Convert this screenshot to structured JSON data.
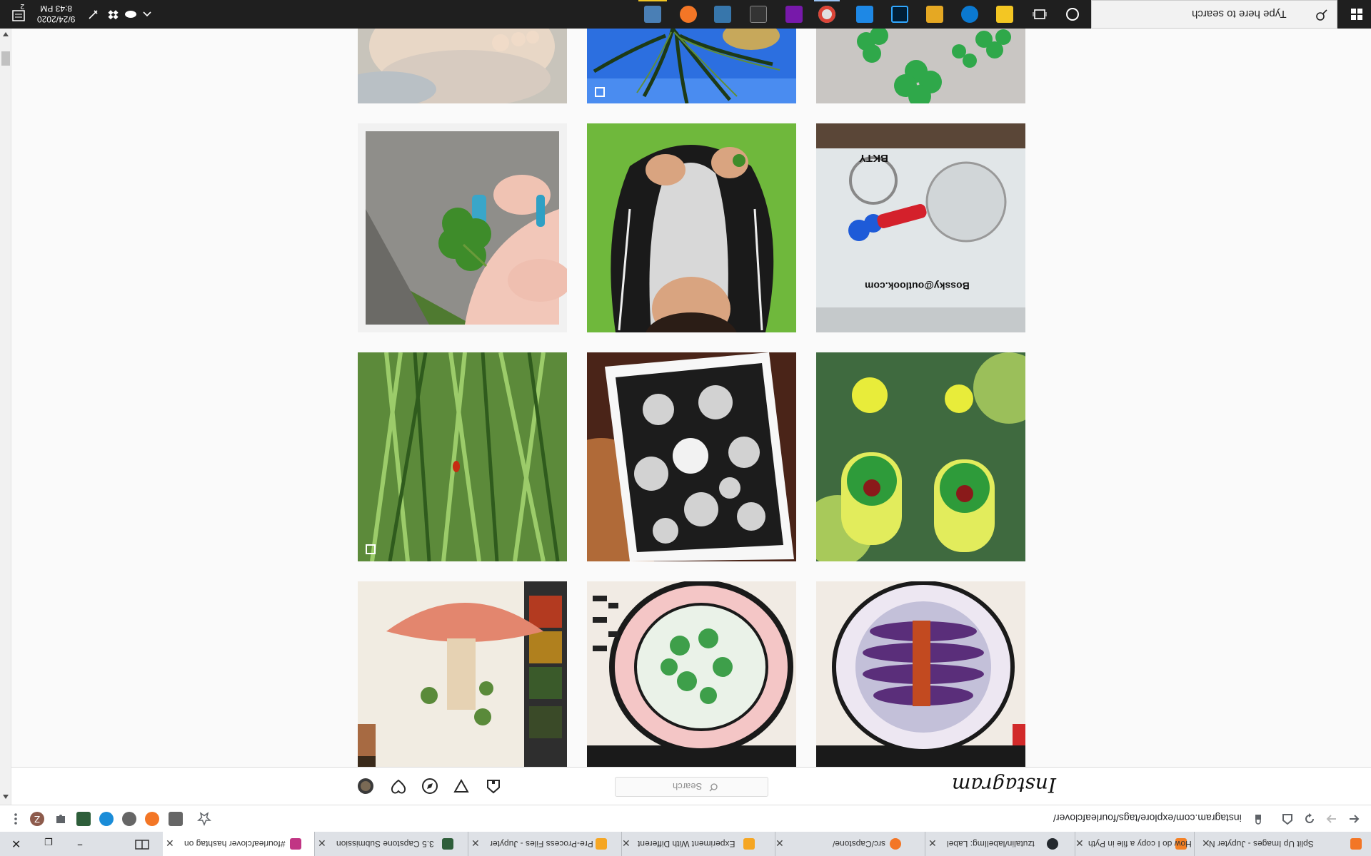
{
  "taskbar": {
    "search_placeholder": "Type here to search",
    "clock_time": "8:43 PM",
    "clock_date": "9/24/2020",
    "notification_count": "2"
  },
  "instagram": {
    "logo": "Instagram",
    "search_placeholder": "Search"
  },
  "browser": {
    "url": "instagram.com/explore/tags/fourleafclover/",
    "tabs": [
      {
        "title": "Split Up Images - Jupyter N"
      },
      {
        "title": "How do I copy a file in Pyth"
      },
      {
        "title": "tzutalin/labelImg: Label"
      },
      {
        "title": "src/Capstone/"
      },
      {
        "title": "Experiment With Different"
      },
      {
        "title": "Pre-Process Files - Jupyter"
      },
      {
        "title": "3.5 Capstone Submission"
      },
      {
        "title": "#fourleafclover hashtag on"
      }
    ]
  },
  "photos": [
    {
      "id": "r0c0",
      "subject": "baby hand",
      "multi": false
    },
    {
      "id": "r0c1",
      "subject": "palm tree",
      "multi": true
    },
    {
      "id": "r0c2",
      "subject": "clover shapes",
      "multi": false
    },
    {
      "id": "r1c0",
      "subject": "four leaf clover in fingers",
      "multi": false
    },
    {
      "id": "r1c1",
      "subject": "child holding clover",
      "multi": false
    },
    {
      "id": "r1c2",
      "subject": "clover keychain",
      "multi": false
    },
    {
      "id": "r2c0",
      "subject": "ladybug on grass",
      "multi": true
    },
    {
      "id": "r2c1",
      "subject": "clover ink drawing",
      "multi": false
    },
    {
      "id": "r2c2",
      "subject": "ladybug clover earrings",
      "multi": false
    },
    {
      "id": "r3c0",
      "subject": "mushroom watercolor",
      "multi": false
    },
    {
      "id": "r3c1",
      "subject": "clover plate painting",
      "multi": false
    },
    {
      "id": "r3c2",
      "subject": "eggplant plate painting",
      "multi": false
    }
  ],
  "photo_texts": {
    "keychain_email": "Bossky@outlook.com",
    "keychain_brand": "BKTY"
  }
}
